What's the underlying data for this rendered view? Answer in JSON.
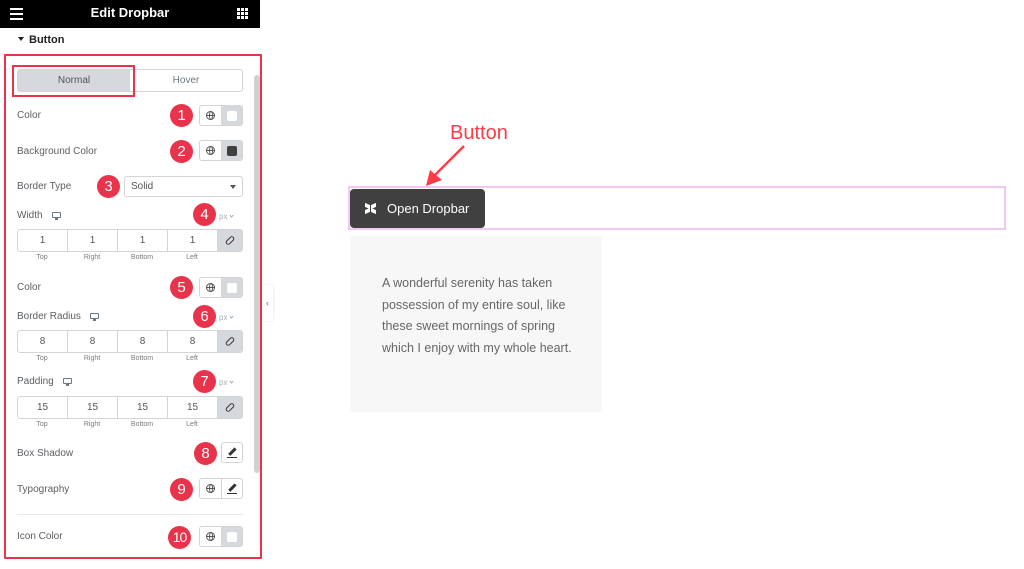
{
  "panel": {
    "title": "Edit Dropbar",
    "section": "Button",
    "tabs": [
      {
        "label": "Normal",
        "active": true
      },
      {
        "label": "Hover",
        "active": false
      }
    ],
    "fields": {
      "color": {
        "label": "Color",
        "value_color": "#ffffff"
      },
      "background_color": {
        "label": "Background Color",
        "value_color": "#404040"
      },
      "border_type": {
        "label": "Border Type",
        "value": "Solid"
      },
      "width": {
        "label": "Width",
        "unit": "px",
        "values": [
          "1",
          "1",
          "1",
          "1"
        ]
      },
      "border_color": {
        "label": "Color",
        "value_color": "#ffffff"
      },
      "border_radius": {
        "label": "Border Radius",
        "unit": "px",
        "values": [
          "8",
          "8",
          "8",
          "8"
        ]
      },
      "padding": {
        "label": "Padding",
        "unit": "px",
        "values": [
          "15",
          "15",
          "15",
          "15"
        ]
      },
      "box_shadow": {
        "label": "Box Shadow"
      },
      "typography": {
        "label": "Typography"
      },
      "icon_color": {
        "label": "Icon Color",
        "value_color": "#ffffff"
      }
    },
    "dim_labels": [
      "Top",
      "Right",
      "Bottom",
      "Left"
    ],
    "collapse_glyph": "‹"
  },
  "badges": [
    "1",
    "2",
    "3",
    "4",
    "5",
    "6",
    "7",
    "8",
    "9",
    "10"
  ],
  "preview": {
    "annotation": "Button",
    "button_label": "Open Dropbar",
    "button_icon": "dropbox-icon",
    "dropbar_text": "A wonderful serenity has taken possession of my entire soul, like these sweet mornings of spring which I enjoy with my whole heart."
  },
  "colors": {
    "highlight": "#e8334a",
    "annotation": "#ff3b47",
    "button_bg": "#404040",
    "widget_outline": "#f2c6f7"
  }
}
